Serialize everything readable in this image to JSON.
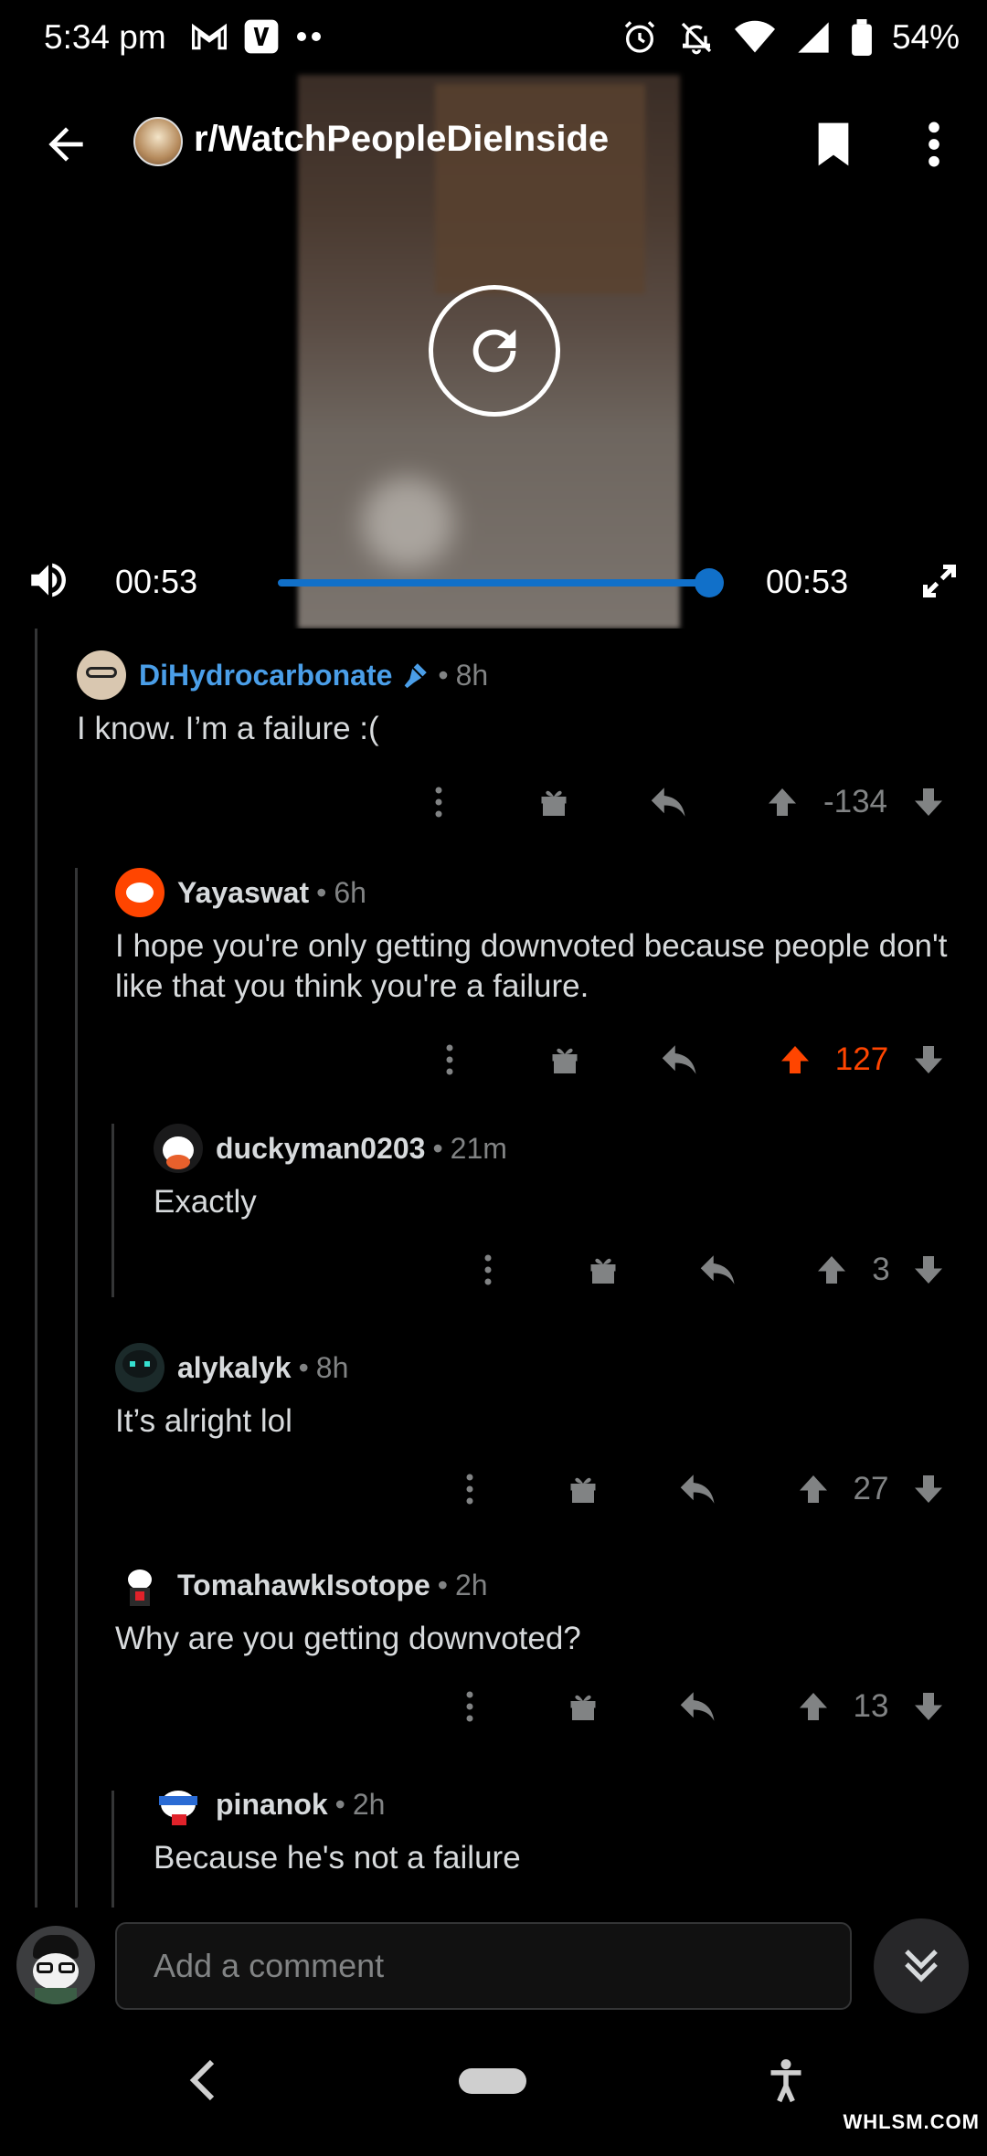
{
  "status_bar": {
    "time": "5:34 pm",
    "battery": "54%"
  },
  "app_bar": {
    "subreddit": "r/WatchPeopleDieInside"
  },
  "video": {
    "current_time": "00:53",
    "duration": "00:53",
    "progress": 1.0,
    "accent_color": "#1170c9"
  },
  "comments": [
    {
      "author": "DiHydrocarbonate",
      "flair_icon": "mic-icon",
      "age": "8h",
      "body": "I know. I’m a failure :(",
      "score": "-134",
      "voted": "none"
    },
    {
      "author": "Yayaswat",
      "age": "6h",
      "body": "I hope you're only getting downvoted because people don't like that you think you're a failure.",
      "score": "127",
      "voted": "up"
    },
    {
      "author": "duckyman0203",
      "age": "21m",
      "body": "Exactly",
      "score": "3",
      "voted": "none"
    },
    {
      "author": "alykalyk",
      "age": "8h",
      "body": "It’s alright lol",
      "score": "27",
      "voted": "none"
    },
    {
      "author": "TomahawkIsotope",
      "age": "2h",
      "body": "Why are you getting downvoted?",
      "score": "13",
      "voted": "none"
    },
    {
      "author": "pinanok",
      "age": "2h",
      "body": "Because he's not a failure",
      "score": "",
      "voted": "none"
    }
  ],
  "composer": {
    "placeholder": "Add a comment"
  },
  "colors": {
    "upvote": "#ff4500",
    "username_highlight": "#4a9ee8",
    "muted": "#818384"
  },
  "watermark": "WHLSM.COM"
}
